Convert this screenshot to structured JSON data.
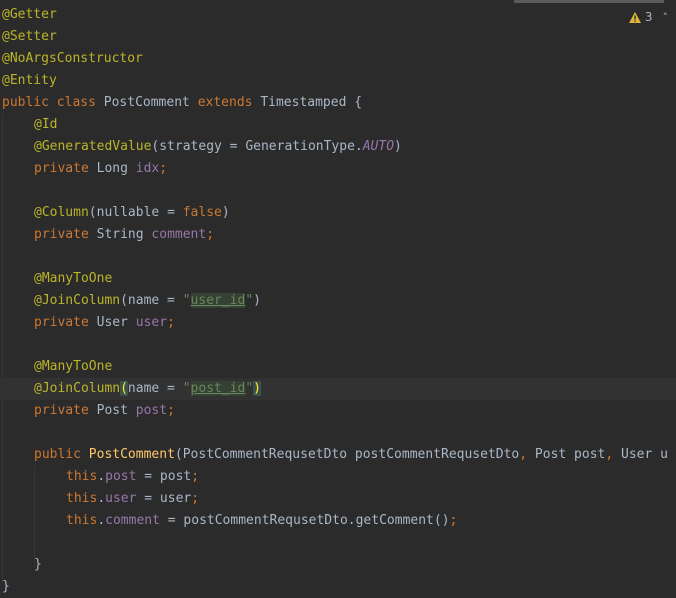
{
  "inspection": {
    "warning_count": "3",
    "collapse_icon": "chevron-up-icon",
    "warning_icon": "warning-triangle-icon"
  },
  "code": {
    "l1": "@Getter",
    "l2": "@Setter",
    "l3": "@NoArgsConstructor",
    "l4": "@Entity",
    "l5": {
      "public": "public",
      "class": "class",
      "name": "PostComment",
      "extends": "extends",
      "base": "Timestamped",
      "brace": "{"
    },
    "l6": "@Id",
    "l7": {
      "ann": "@GeneratedValue",
      "args": "(strategy = GenerationType.",
      "enum": "AUTO",
      "close": ")"
    },
    "l8": {
      "private": "private",
      "type": "Long",
      "field": "idx",
      "semi": ";"
    },
    "l9": {
      "ann": "@Column",
      "open": "(nullable = ",
      "val": "false",
      "close": ")"
    },
    "l10": {
      "private": "private",
      "type": "String",
      "field": "comment",
      "semi": ";"
    },
    "l11": "@ManyToOne",
    "l12": {
      "ann": "@JoinColumn",
      "open": "(name = ",
      "q1": "\"",
      "str": "user_id",
      "q2": "\"",
      "close": ")"
    },
    "l13": {
      "private": "private",
      "type": "User",
      "field": "user",
      "semi": ";"
    },
    "l14": "@ManyToOne",
    "l15": {
      "ann": "@JoinColumn",
      "open": "(",
      "name": "name = ",
      "q1": "\"",
      "str": "post_id",
      "q2": "\"",
      "close": ")"
    },
    "l16": {
      "private": "private",
      "type": "Post",
      "field": "post",
      "semi": ";"
    },
    "l17": {
      "public": "public",
      "name": "PostComment",
      "p1": "(PostCommentRequsetDto postCommentRequsetDto",
      "c1": ",",
      "p2": " Post post",
      "c2": ",",
      "p3": " User u"
    },
    "l18": {
      "this": "this",
      "dot": ".",
      "field": "post",
      "rest": " = post",
      "semi": ";"
    },
    "l19": {
      "this": "this",
      "dot": ".",
      "field": "user",
      "rest": " = user",
      "semi": ";"
    },
    "l20": {
      "this": "this",
      "dot": ".",
      "field": "comment",
      "rest": " = postCommentRequsetDto.getComment()",
      "semi": ";"
    },
    "l21": "}",
    "l22": "}"
  }
}
